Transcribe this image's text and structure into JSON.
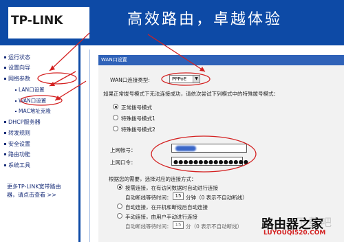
{
  "header": {
    "logo": "TP-LINK",
    "slogan": "高效路由，卓越体验"
  },
  "sidebar": {
    "items": [
      {
        "label": "运行状态"
      },
      {
        "label": "设置向导"
      },
      {
        "label": "网络参数"
      },
      {
        "label": "LAN口设置"
      },
      {
        "label": "WAN口设置"
      },
      {
        "label": "MAC地址克隆"
      },
      {
        "label": "DHCP服务器"
      },
      {
        "label": "转发规则"
      },
      {
        "label": "安全设置"
      },
      {
        "label": "路由功能"
      },
      {
        "label": "系统工具"
      }
    ],
    "note_line1": "更多TP-LINK宽带路由",
    "note_line2": "器，请点击查看 >>"
  },
  "panel": {
    "title": "WAN口设置",
    "conn_type_label": "WAN口连接类型:",
    "conn_type_value": "PPPoE",
    "hint": "如果正常拨号模式下无法连接成功，请依次尝试下列模式中的特殊拨号模式：",
    "dial_modes": [
      {
        "label": "正常拨号模式",
        "checked": true
      },
      {
        "label": "特殊拨号模式1",
        "checked": false
      },
      {
        "label": "特殊拨号模式2",
        "checked": false
      }
    ],
    "account_label": "上网帐号：",
    "password_label": "上网口令：",
    "password_value": "●●●●●●●●●●●●●●●",
    "connect_hint": "根据您的需要，选择对应的连接方式：",
    "connect_modes": [
      {
        "label": "按需连接，在有访问数据时自动进行连接",
        "checked": true
      },
      {
        "label": "自动连接，在开机和断线后自动连接",
        "checked": false
      },
      {
        "label": "手动连接，由用户手动进行连接",
        "checked": false
      }
    ],
    "idle_label": "自动断线等待时间：",
    "idle_value_1": "15",
    "idle_unit_1": "分钟（0 表示不自动断线）",
    "idle_value_2": "15",
    "idle_unit_2": "分（0 表示不自动断线）"
  },
  "watermark": {
    "logo": "路由器之家",
    "url": "LUYOUQI520.COM"
  },
  "colors": {
    "header_bg": "#0d4aa6",
    "panel_title_bg": "#2f62b8",
    "annotation": "#d42020"
  }
}
